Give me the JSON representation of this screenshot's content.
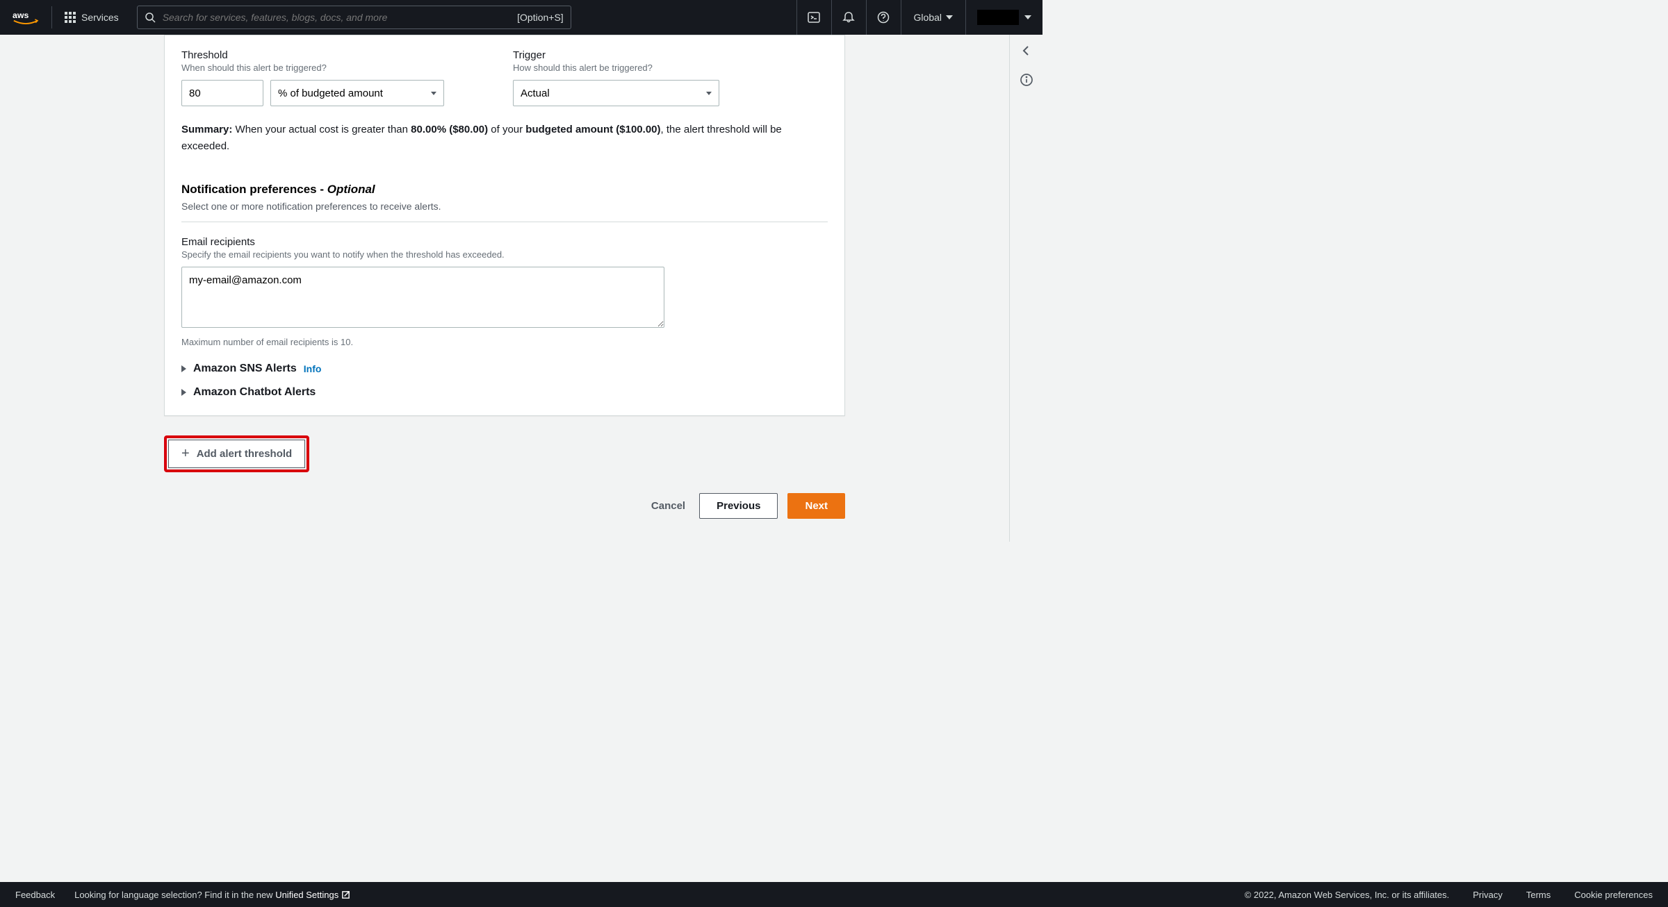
{
  "topnav": {
    "services_label": "Services",
    "search_placeholder": "Search for services, features, blogs, docs, and more",
    "shortcut": "[Option+S]",
    "region": "Global"
  },
  "form": {
    "threshold": {
      "label": "Threshold",
      "desc": "When should this alert be triggered?",
      "value": "80",
      "unit": "% of budgeted amount"
    },
    "trigger": {
      "label": "Trigger",
      "desc": "How should this alert be triggered?",
      "value": "Actual"
    },
    "summary": {
      "prefix": "Summary: ",
      "t1": "When your actual cost is greater than ",
      "pct": "80.00% ($80.00)",
      "t2": " of your ",
      "budget": "budgeted amount ($100.00)",
      "t3": ", the alert threshold will be exceeded."
    },
    "notif": {
      "header": "Notification preferences - ",
      "optional": "Optional",
      "sub": "Select one or more notification preferences to receive alerts."
    },
    "email": {
      "label": "Email recipients",
      "desc": "Specify the email recipients you want to notify when the threshold has exceeded.",
      "value": "my-email@amazon.com",
      "hint": "Maximum number of email recipients is 10."
    },
    "expanders": {
      "sns": "Amazon SNS Alerts",
      "sns_info": "Info",
      "chatbot": "Amazon Chatbot Alerts"
    },
    "add_btn": "Add alert threshold",
    "cancel": "Cancel",
    "previous": "Previous",
    "next": "Next"
  },
  "footer": {
    "feedback": "Feedback",
    "lang_prompt": "Looking for language selection? Find it in the new ",
    "unified": "Unified Settings",
    "copyright": "© 2022, Amazon Web Services, Inc. or its affiliates.",
    "privacy": "Privacy",
    "terms": "Terms",
    "cookie": "Cookie preferences"
  }
}
